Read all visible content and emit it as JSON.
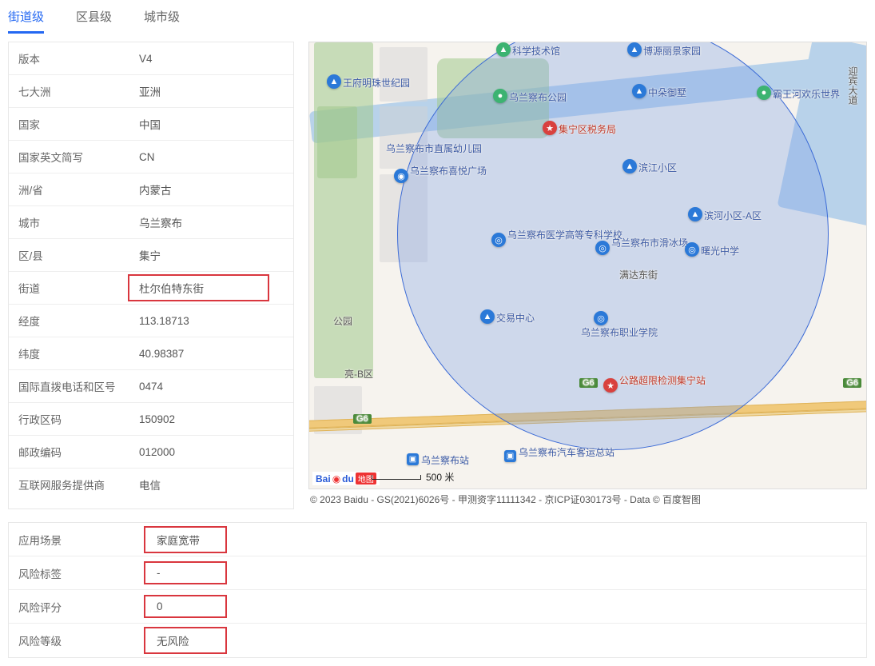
{
  "tabs": {
    "street": "街道级",
    "district": "区县级",
    "city": "城市级"
  },
  "info": {
    "version_label": "版本",
    "version": "V4",
    "continent_label": "七大洲",
    "continent": "亚洲",
    "country_label": "国家",
    "country": "中国",
    "country_en_label": "国家英文简写",
    "country_en": "CN",
    "province_label": "洲/省",
    "province": "内蒙古",
    "city_label": "城市",
    "city": "乌兰察布",
    "county_label": "区/县",
    "county": "集宁",
    "street_label": "街道",
    "street": "杜尔伯特东街",
    "lng_label": "经度",
    "lng": "113.18713",
    "lat_label": "纬度",
    "lat": "40.98387",
    "phone_label": "国际直拨电话和区号",
    "phone": "0474",
    "admin_label": "行政区码",
    "admin": "150902",
    "zip_label": "邮政编码",
    "zip": "012000",
    "isp_label": "互联网服务提供商",
    "isp": "电信"
  },
  "lower": {
    "scene_label": "应用场景",
    "scene": "家庭宽带",
    "risk_tag_label": "风险标签",
    "risk_tag": "-",
    "risk_score_label": "风险评分",
    "risk_score": "0",
    "risk_level_label": "风险等级",
    "risk_level": "无风险"
  },
  "map": {
    "scale_text": "500 米",
    "credit": "© 2023 Baidu - GS(2021)6026号 - 甲测资字11111342 - 京ICP证030173号 - Data © 百度智图",
    "logo_text": "地图",
    "road_mandadong": "满达东街",
    "road_g6a": "G6",
    "road_g6b": "G6",
    "pois": {
      "kexue": "科学技术馆",
      "boyuan": "博源丽景家园",
      "wangfu": "王府明珠世纪园",
      "wulan_park": "乌兰察布公园",
      "zhongduo": "中朵御墅",
      "bawang": "霸王河欢乐世界",
      "jining_tax": "集宁区税务局",
      "youeryuan1": "乌兰察布市直属幼儿园",
      "xiyue": "乌兰察布喜悦广场",
      "binjiang": "滨江小区",
      "binhe_a": "滨河小区-A区",
      "yixue": "乌兰察布医学高等专科学校",
      "bingchang": "乌兰察布市滑冰场",
      "shuguang": "曙光中学",
      "jiaoyi": "交易中心",
      "zhiye": "乌兰察布职业学院",
      "gonglu": "公路超限检测集宁站",
      "buzhan": "乌兰察布站",
      "keyunzhan": "乌兰察布汽车客运总站",
      "huibin": "迎宾大道",
      "gongyuan_w": "公园",
      "liang_b": "亮-B区"
    }
  }
}
